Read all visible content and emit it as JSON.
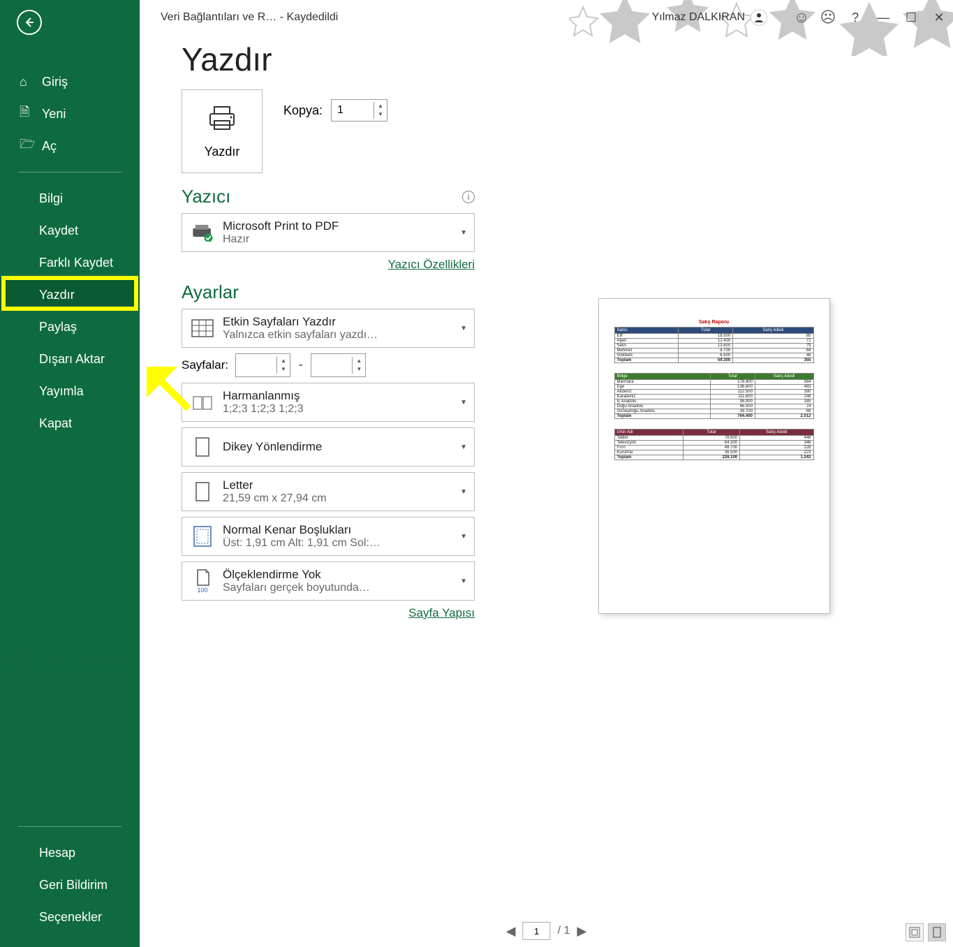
{
  "title": {
    "doc": "Veri Bağlantıları ve R…  - Kaydedildi",
    "user": "Yılmaz DALKIRAN"
  },
  "sidebar": {
    "top": [
      {
        "icon": "home",
        "label": "Giriş"
      },
      {
        "icon": "file",
        "label": "Yeni"
      },
      {
        "icon": "folder",
        "label": "Aç"
      }
    ],
    "sub": [
      {
        "label": "Bilgi"
      },
      {
        "label": "Kaydet"
      },
      {
        "label": "Farklı Kaydet"
      },
      {
        "label": "Yazdır",
        "active": true
      },
      {
        "label": "Paylaş"
      },
      {
        "label": "Dışarı Aktar"
      },
      {
        "label": "Yayımla"
      },
      {
        "label": "Kapat"
      }
    ],
    "footer": [
      {
        "label": "Hesap"
      },
      {
        "label": "Geri Bildirim"
      },
      {
        "label": "Seçenekler"
      }
    ]
  },
  "page_title": "Yazdır",
  "print_button": "Yazdır",
  "copies": {
    "label": "Kopya:",
    "value": "1"
  },
  "printer_section": "Yazıcı",
  "printer": {
    "name": "Microsoft Print to PDF",
    "status": "Hazır",
    "props_link": "Yazıcı Özellikleri"
  },
  "settings_section": "Ayarlar",
  "settings": {
    "sheets": {
      "title": "Etkin Sayfaları Yazdır",
      "sub": "Yalnızca etkin sayfaları yazdı…"
    },
    "pages_label": "Sayfalar:",
    "collate": {
      "title": "Harmanlanmış",
      "sub": "1;2;3    1;2;3    1;2;3"
    },
    "orientation": {
      "title": "Dikey Yönlendirme"
    },
    "paper": {
      "title": "Letter",
      "sub": "21,59 cm x 27,94 cm"
    },
    "margins": {
      "title": "Normal Kenar Boşlukları",
      "sub": "Üst: 1,91 cm Alt: 1,91 cm Sol:…"
    },
    "scale": {
      "title": "Ölçeklendirme Yok",
      "sub": "Sayfaları gerçek boyutunda…",
      "badge": "100"
    },
    "page_setup": "Sayfa Yapısı"
  },
  "nav": {
    "page": "1",
    "of": "/ 1"
  },
  "preview": {
    "report_title": "Satış Raporu",
    "headers": [
      "Tutar",
      "Satış Adedi"
    ],
    "tbl1": {
      "key": "Satıcı",
      "rows": [
        [
          "Elif",
          "18.500",
          "85"
        ],
        [
          "Alper",
          "12.400",
          "71"
        ],
        [
          "Selin",
          "13.600",
          "79"
        ],
        [
          "Mehmet",
          "8.700",
          "64"
        ],
        [
          "Gökberk",
          "6.500",
          "48"
        ]
      ],
      "total": [
        "Toplam",
        "59.300",
        "355"
      ]
    },
    "tbl2": {
      "key": "Bölge",
      "rows": [
        [
          "Marmara",
          "178.400",
          "564"
        ],
        [
          "Ege",
          "136.800",
          "483"
        ],
        [
          "Akdeniz",
          "112.500",
          "390"
        ],
        [
          "Karadeniz",
          "111.600",
          "248"
        ],
        [
          "İç Anadolu",
          "98.900",
          "185"
        ],
        [
          "Doğu Anadolu",
          "66.500",
          "74"
        ],
        [
          "Güneydoğu Anadolu",
          "39.700",
          "68"
        ]
      ],
      "total": [
        "Toplam",
        "764.400",
        "2.012"
      ]
    },
    "tbl3": {
      "key": "Ürün Adı",
      "rows": [
        [
          "Tablet",
          "78.600",
          "448"
        ],
        [
          "Televizyon",
          "64.300",
          "346"
        ],
        [
          "Fırın",
          "48.700",
          "228"
        ],
        [
          "Kurutma",
          "36.500",
          "223"
        ]
      ],
      "total": [
        "Toplam",
        "228.100",
        "1.243"
      ]
    }
  }
}
